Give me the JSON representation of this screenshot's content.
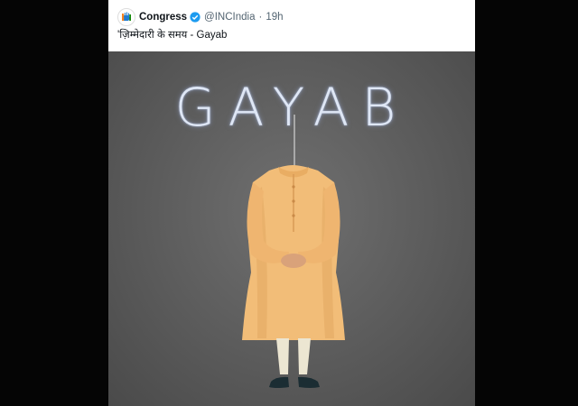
{
  "tweet": {
    "display_name": "Congress",
    "handle": "@INCIndia",
    "separator": "·",
    "time": "19h",
    "text": "'ज़िम्मेदारी के समय - Gayab",
    "verified_color": "#1d9bf0"
  },
  "media": {
    "overlay_text": "GAYAB",
    "kurta_color": "#f3c07f",
    "background_color": "#5f5f5f"
  },
  "icons": {
    "avatar": "congress-hand-logo",
    "verified": "verified-badge-icon"
  }
}
